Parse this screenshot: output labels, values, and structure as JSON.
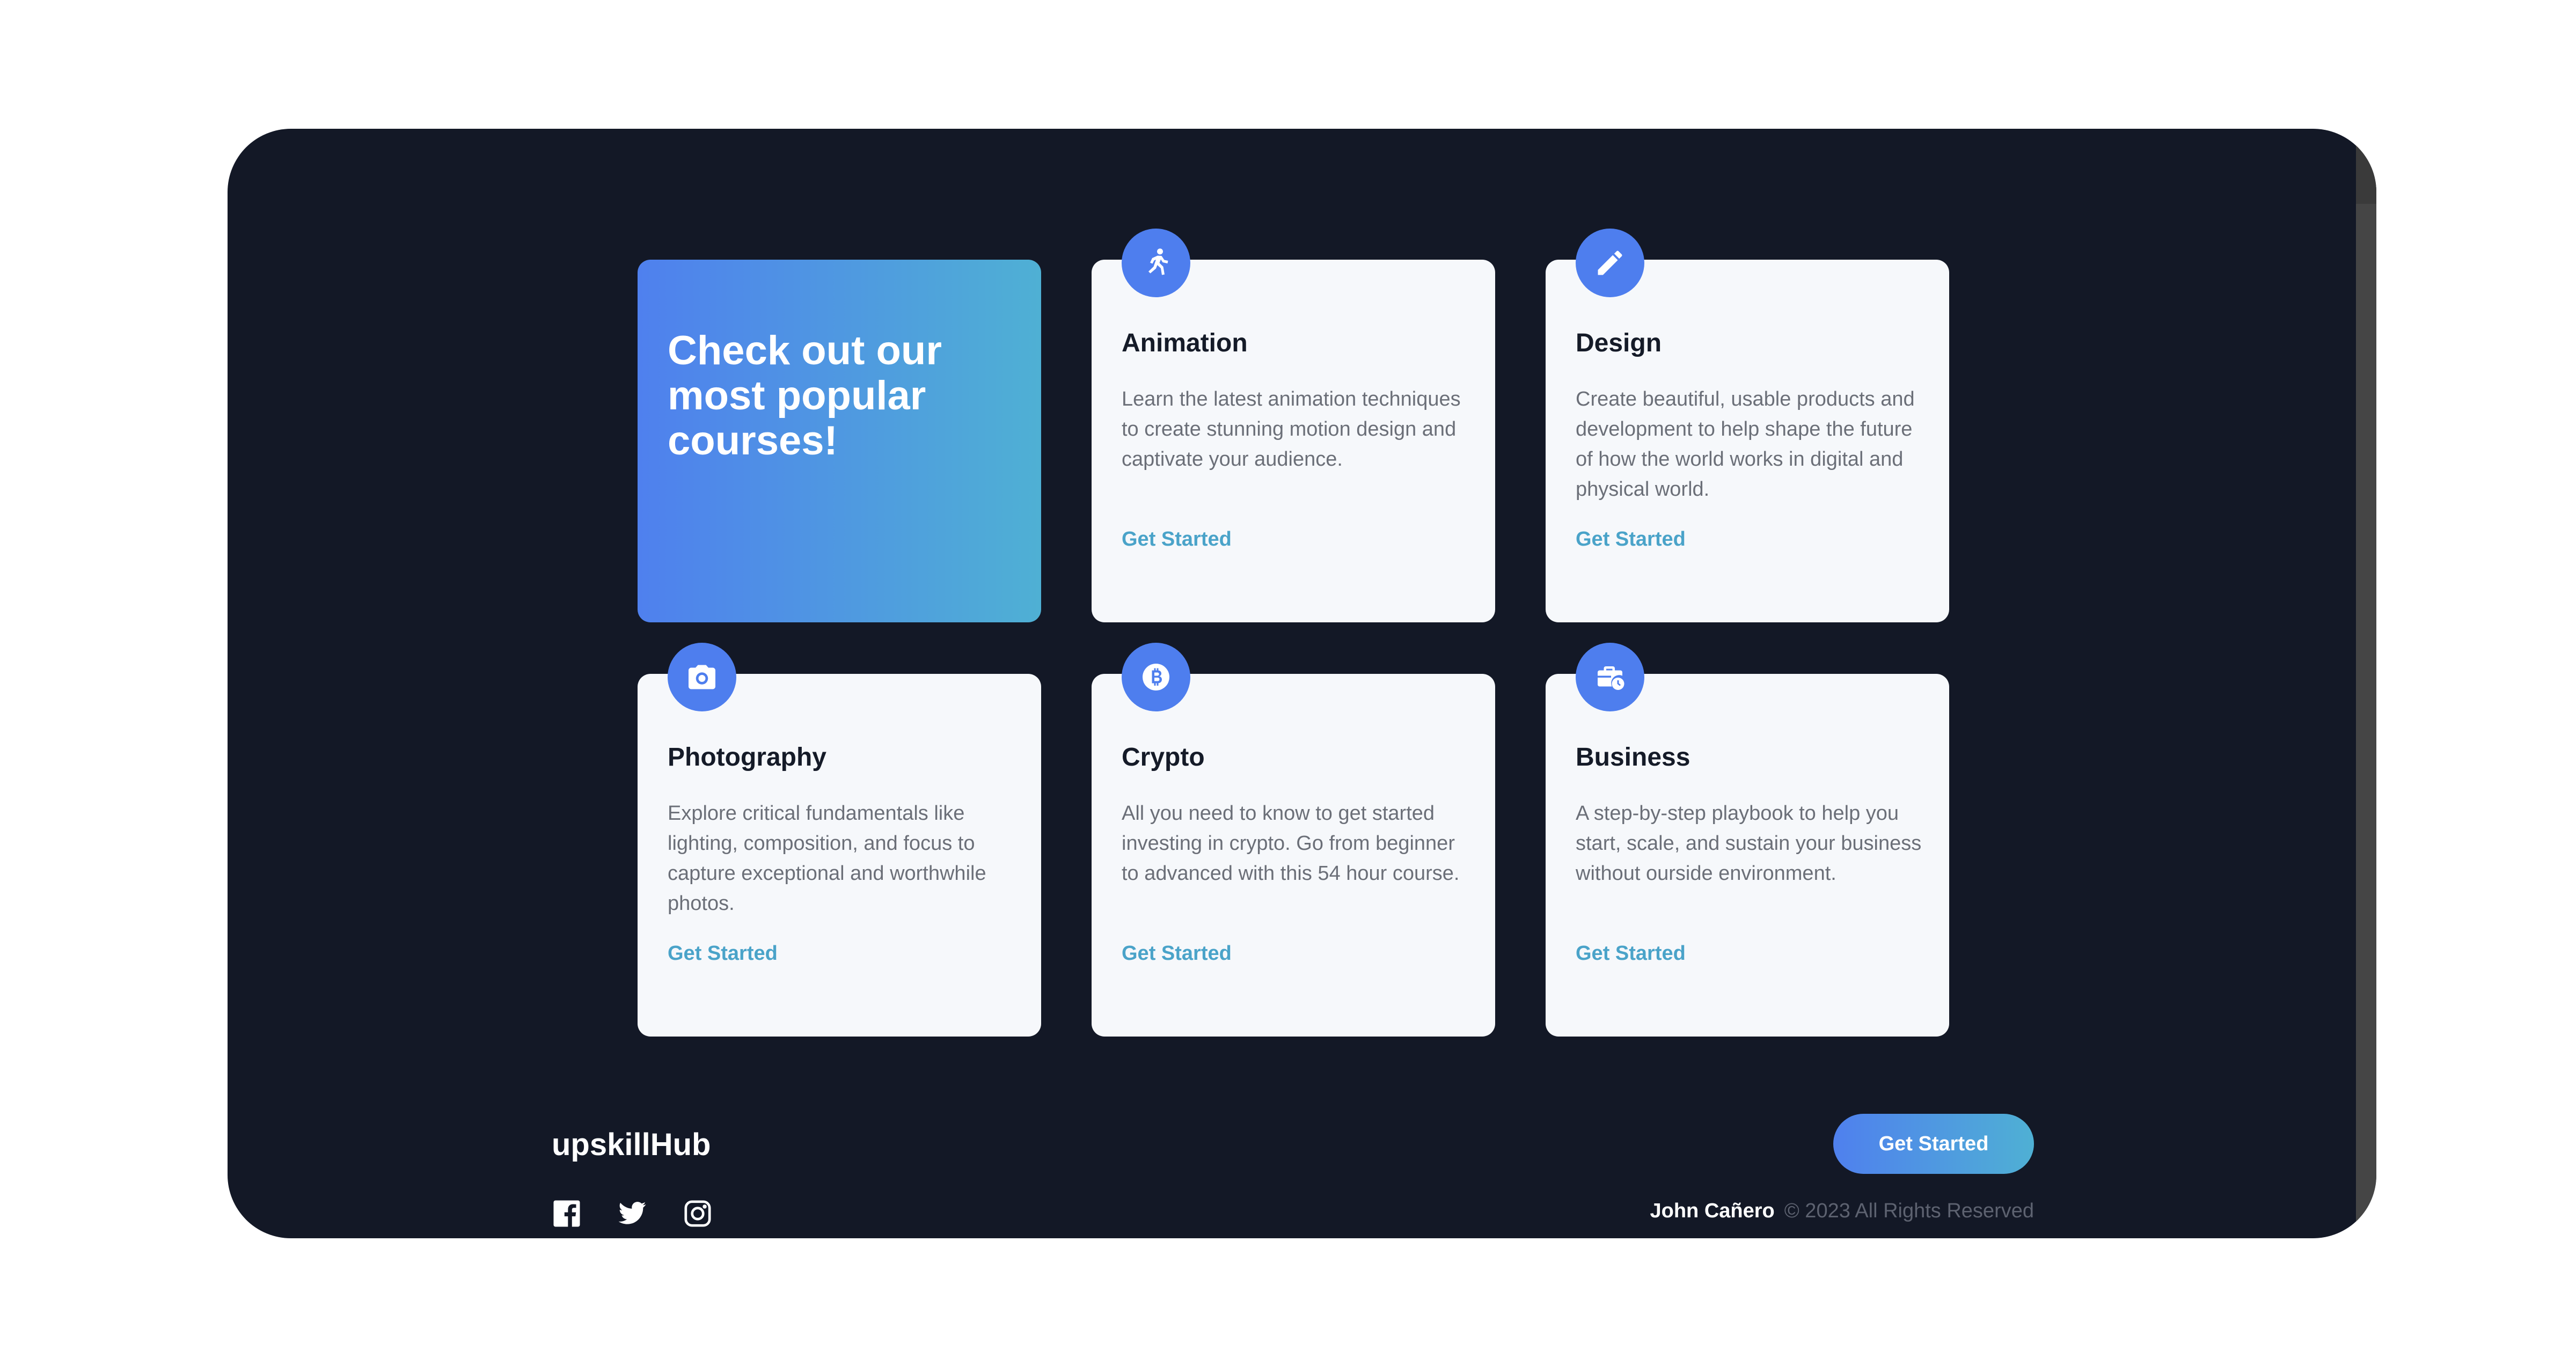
{
  "hero": {
    "title": "Check out our most popular courses!"
  },
  "courses": [
    {
      "title": "Animation",
      "icon": "running-figure-icon",
      "description": "Learn the latest animation techniques to create stunning motion design and captivate your audience.",
      "link": "Get Started"
    },
    {
      "title": "Design",
      "icon": "pencil-icon",
      "description": "Create beautiful, usable products and development to help shape the future of how the world works in digital and physical world.",
      "link": "Get Started"
    },
    {
      "title": "Photography",
      "icon": "camera-icon",
      "description": "Explore critical fundamentals like lighting, composition, and focus to capture exceptional and worthwhile photos.",
      "link": "Get Started"
    },
    {
      "title": "Crypto",
      "icon": "bitcoin-icon",
      "description": "All you need to know to get started investing in crypto. Go from beginner to advanced with this 54 hour course.",
      "link": "Get Started"
    },
    {
      "title": "Business",
      "icon": "briefcase-clock-icon",
      "description": "A step-by-step playbook to help you start, scale, and sustain your business without ourside environment.",
      "link": "Get Started"
    }
  ],
  "footer": {
    "logo": "upskillHub",
    "cta": "Get Started",
    "author": "John Cañero",
    "copyright": "© 2023 All Rights Reserved",
    "socials": [
      "facebook-icon",
      "twitter-icon",
      "instagram-icon"
    ]
  },
  "colors": {
    "background": "#131826",
    "accent": "#4e7eee",
    "accent_gradient_end": "#4fb0d4",
    "link": "#4aa3c9",
    "card": "#f6f8fb"
  }
}
